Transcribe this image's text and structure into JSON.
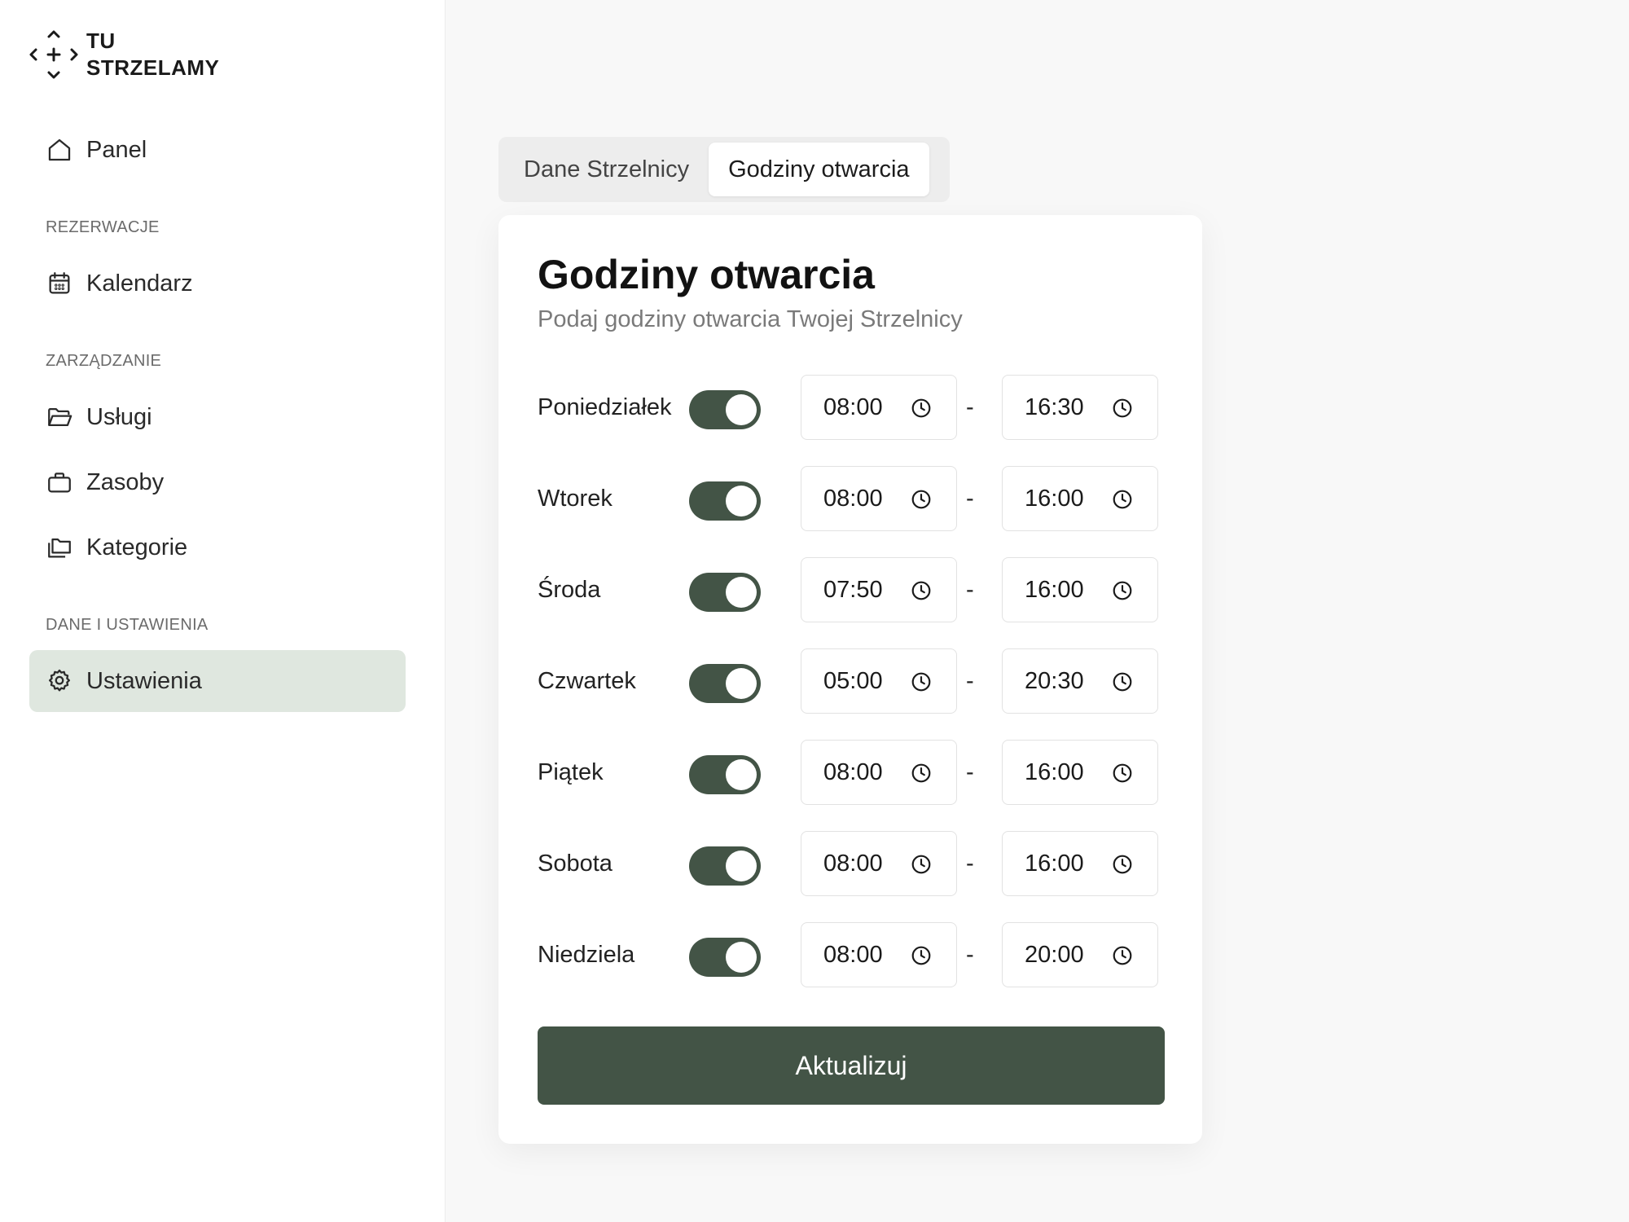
{
  "brand": {
    "line1": "TU",
    "line2": "STRZELAMY"
  },
  "sidebar": {
    "panel": "Panel",
    "sections": [
      {
        "label": "REZERWACJE"
      },
      {
        "label": "ZARZĄDZANIE"
      },
      {
        "label": "DANE I USTAWIENIA"
      }
    ],
    "items": [
      {
        "label": "Kalendarz",
        "icon": "calendar-icon"
      },
      {
        "label": "Usługi",
        "icon": "folder-open-icon"
      },
      {
        "label": "Zasoby",
        "icon": "briefcase-icon"
      },
      {
        "label": "Kategorie",
        "icon": "folders-icon"
      },
      {
        "label": "Ustawienia",
        "icon": "gear-icon",
        "active": true
      }
    ]
  },
  "tabs": [
    {
      "label": "Dane Strzelnicy",
      "active": false
    },
    {
      "label": "Godziny otwarcia",
      "active": true
    }
  ],
  "card": {
    "title": "Godziny otwarcia",
    "subtitle": "Podaj godziny otwarcia Twojej Strzelnicy",
    "separator": "-",
    "days": [
      {
        "name": "Poniedziałek",
        "enabled": true,
        "from": "08:00",
        "to": "16:30"
      },
      {
        "name": "Wtorek",
        "enabled": true,
        "from": "08:00",
        "to": "16:00"
      },
      {
        "name": "Środa",
        "enabled": true,
        "from": "07:50",
        "to": "16:00"
      },
      {
        "name": "Czwartek",
        "enabled": true,
        "from": "05:00",
        "to": "20:30"
      },
      {
        "name": "Piątek",
        "enabled": true,
        "from": "08:00",
        "to": "16:00"
      },
      {
        "name": "Sobota",
        "enabled": true,
        "from": "08:00",
        "to": "16:00"
      },
      {
        "name": "Niedziela",
        "enabled": true,
        "from": "08:00",
        "to": "20:00"
      }
    ],
    "submit_label": "Aktualizuj"
  },
  "colors": {
    "accent": "#435446",
    "active_nav_bg": "#dfe7df",
    "page_bg": "#f8f8f8"
  }
}
